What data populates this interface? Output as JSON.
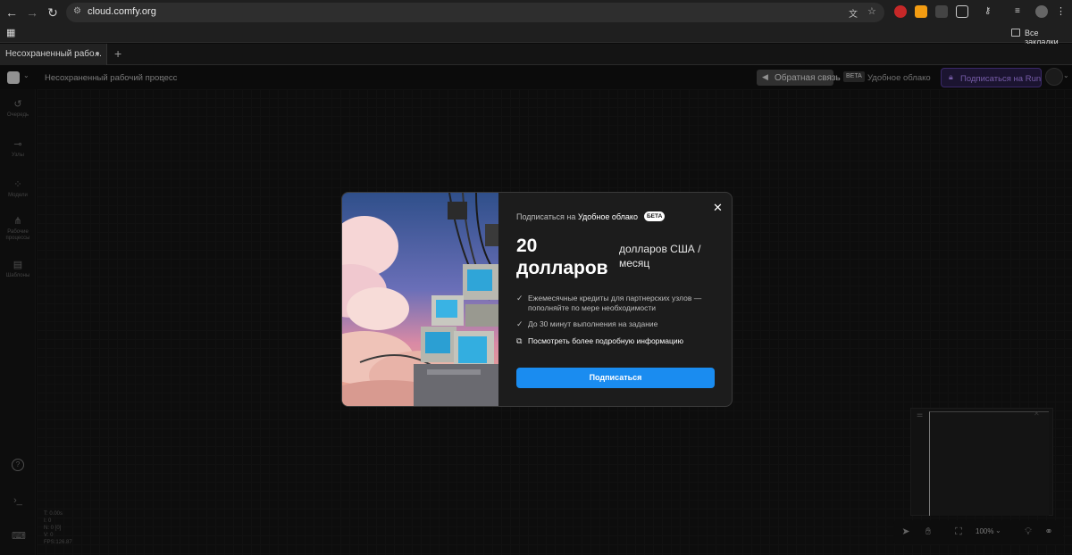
{
  "browser": {
    "url": "cloud.comfy.org",
    "bookmarks_label": "Все закладки"
  },
  "tabs": {
    "active_title": "Несохраненный рабо...",
    "add_label": "+"
  },
  "header": {
    "workflow_title": "Несохраненный рабочий процесс",
    "feedback_label": "Обратная связь",
    "beta_badge": "BETA",
    "cloud_label": "Удобное облако",
    "subscribe_label": "Подписаться на Run"
  },
  "sidebar": {
    "items": [
      {
        "label": "Очередь",
        "icon": "history-icon"
      },
      {
        "label": "Узлы",
        "icon": "nodes-icon"
      },
      {
        "label": "Модели",
        "icon": "models-icon"
      },
      {
        "label": "Рабочие процессы",
        "icon": "workflows-icon"
      },
      {
        "label": "Шаблоны",
        "icon": "templates-icon"
      }
    ]
  },
  "modal": {
    "subscribe_prefix": "Подписаться на",
    "product_name": "Удобное облако",
    "beta_badge": "БЕТА",
    "price_amount": "20 долларов",
    "price_unit": "долларов США / месяц",
    "features": [
      "Ежемесячные кредиты для партнерских узлов — пополняйте по мере необходимости",
      "До 30 минут выполнения на задание"
    ],
    "more_info_link": "Посмотреть более подробную информацию",
    "subscribe_button": "Подписаться"
  },
  "stats": {
    "t": "T: 0.00s",
    "i": "I: 0",
    "n": "N: 0 [0]",
    "v": "V: 0",
    "fps": "FPS:126.87"
  },
  "toolbar": {
    "zoom": "100%"
  },
  "colors": {
    "accent_blue": "#1a8cf0",
    "subscribe_purple": "#2a1f4a"
  }
}
